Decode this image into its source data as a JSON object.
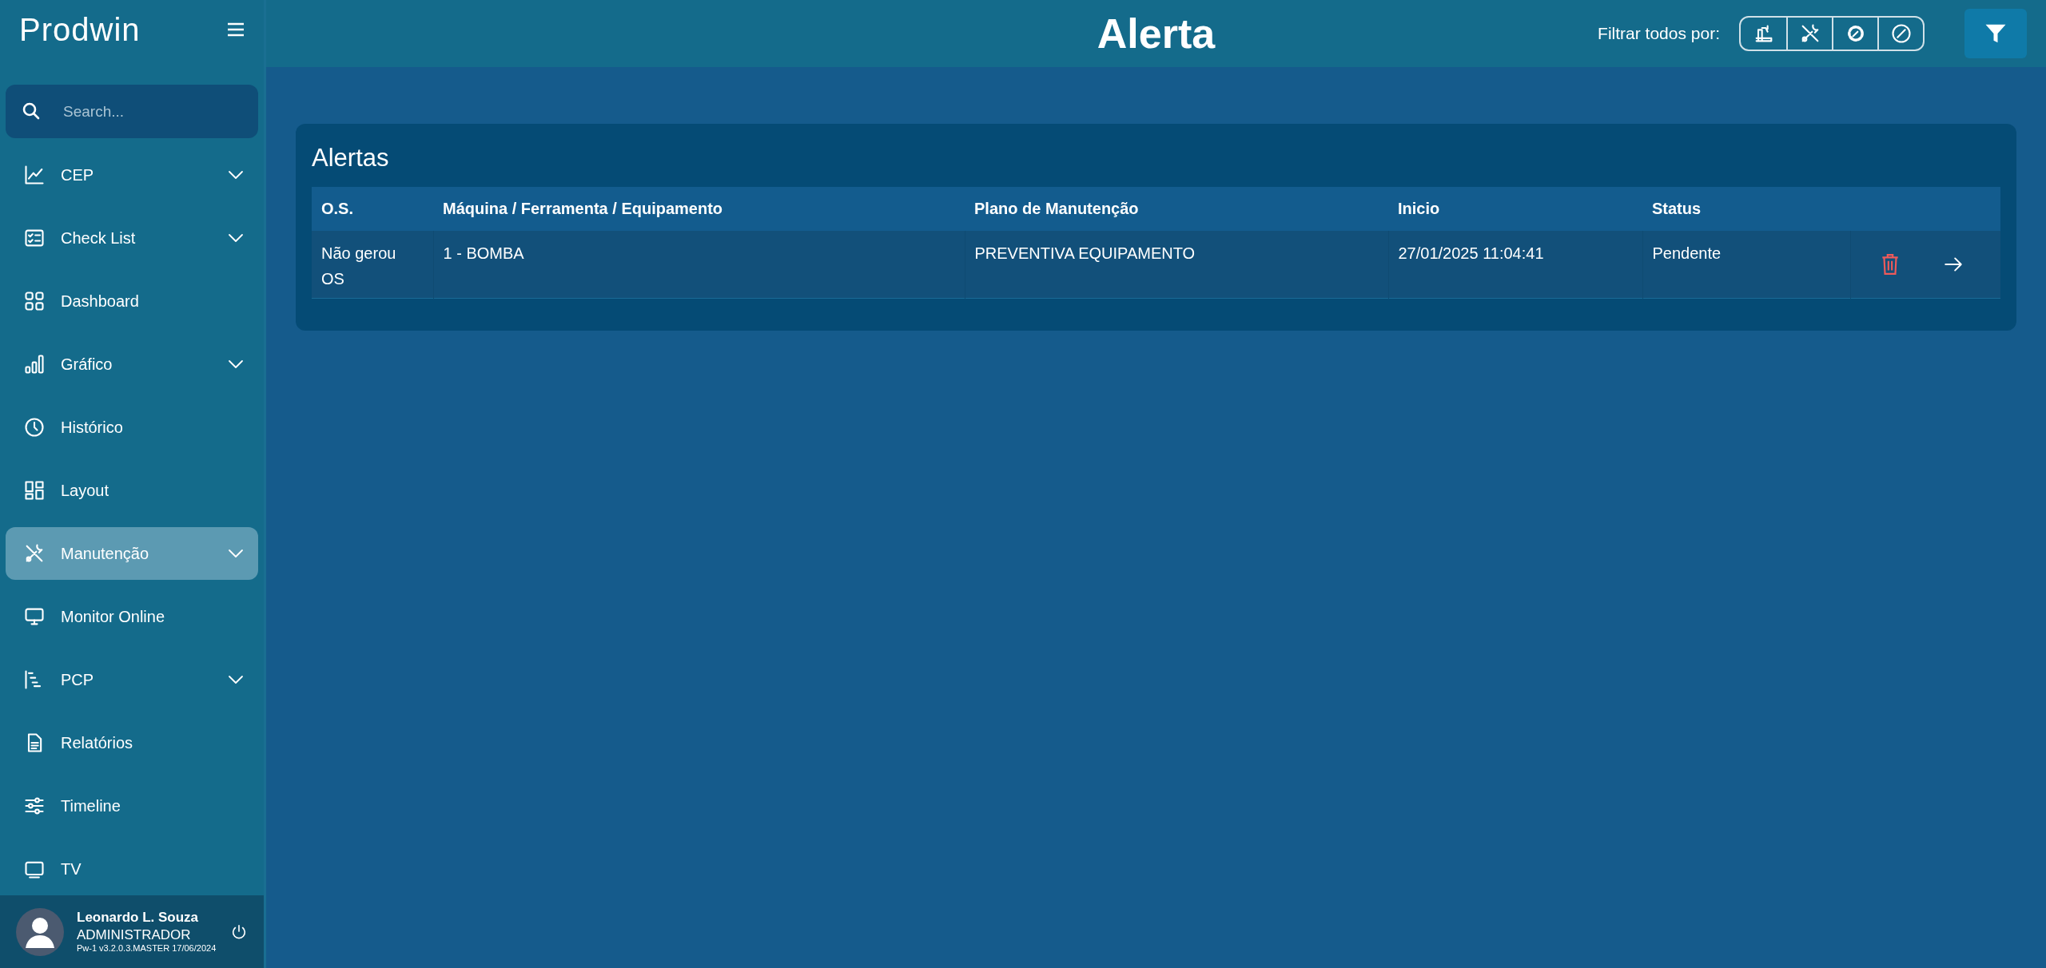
{
  "sidebar": {
    "logo": "Prodwin",
    "search": {
      "placeholder": "Search..."
    },
    "items": [
      {
        "label": "CEP",
        "has_submenu": true,
        "selected": false
      },
      {
        "label": "Check List",
        "has_submenu": true,
        "selected": false
      },
      {
        "label": "Dashboard",
        "has_submenu": false,
        "selected": false
      },
      {
        "label": "Gráfico",
        "has_submenu": true,
        "selected": false
      },
      {
        "label": "Histórico",
        "has_submenu": false,
        "selected": false
      },
      {
        "label": "Layout",
        "has_submenu": false,
        "selected": false
      },
      {
        "label": "Manutenção",
        "has_submenu": true,
        "selected": true
      },
      {
        "label": "Monitor Online",
        "has_submenu": false,
        "selected": false
      },
      {
        "label": "PCP",
        "has_submenu": true,
        "selected": false
      },
      {
        "label": "Relatórios",
        "has_submenu": false,
        "selected": false
      },
      {
        "label": "Timeline",
        "has_submenu": false,
        "selected": false
      },
      {
        "label": "TV",
        "has_submenu": false,
        "selected": false
      }
    ],
    "user": {
      "name": "Leonardo L. Souza",
      "role": "ADMINISTRADOR",
      "version": "Pw-1 v3.2.0.3.MASTER 17/06/2024"
    }
  },
  "header": {
    "title": "Alerta",
    "filter_label": "Filtrar todos por:"
  },
  "card": {
    "title": "Alertas",
    "columns": [
      "O.S.",
      "Máquina / Ferramenta / Equipamento",
      "Plano de Manutenção",
      "Inicio",
      "Status"
    ],
    "rows": [
      {
        "cells": [
          "Não gerou OS",
          "1 - BOMBA",
          "PREVENTIVA EQUIPAMENTO",
          "27/01/2025 11:04:41",
          "Pendente"
        ]
      }
    ]
  }
}
